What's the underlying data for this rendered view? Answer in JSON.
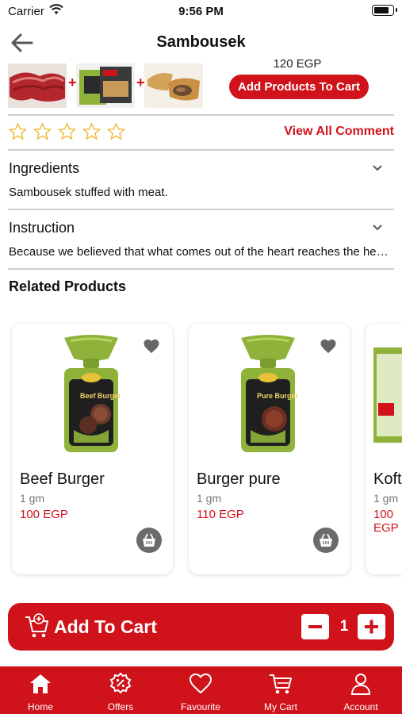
{
  "status_bar": {
    "carrier": "Carrier",
    "time": "9:56 PM"
  },
  "nav": {
    "title": "Sambousek"
  },
  "bundle": {
    "price": "120 EGP",
    "add_products_label": "Add Products To Cart"
  },
  "rating": {
    "stars_filled": 0,
    "stars_total": 5,
    "view_all_label": "View All Comment"
  },
  "ingredients": {
    "title": "Ingredients",
    "text": "Sambousek stuffed with meat."
  },
  "instruction": {
    "title": "Instruction",
    "text": "Because we believed that what comes out of the heart reaches the heart"
  },
  "related": {
    "title": "Related Products",
    "products": [
      {
        "name": "Beef Burger",
        "unit": "1 gm",
        "price": "100 EGP",
        "pack_label": "Beef Burger"
      },
      {
        "name": "Burger pure",
        "unit": "1 gm",
        "price": "110 EGP",
        "pack_label": "Pure Burger"
      },
      {
        "name": "Kofta",
        "unit": "1 gm",
        "price": "100 EGP"
      }
    ]
  },
  "cart_bar": {
    "label": "Add To Cart",
    "quantity": "1"
  },
  "tabs": [
    {
      "label": "Home",
      "icon": "home-icon"
    },
    {
      "label": "Offers",
      "icon": "offers-icon"
    },
    {
      "label": "Favourite",
      "icon": "heart-icon"
    },
    {
      "label": "My Cart",
      "icon": "cart-icon"
    },
    {
      "label": "Account",
      "icon": "account-icon"
    }
  ],
  "colors": {
    "accent": "#d0121b",
    "pack_green": "#8fb33a"
  }
}
